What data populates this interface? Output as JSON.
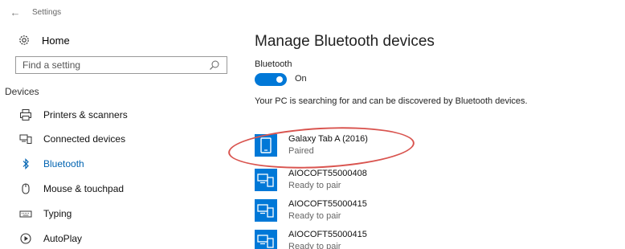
{
  "window": {
    "title": "Settings"
  },
  "sidebar": {
    "home_label": "Home",
    "search_placeholder": "Find a setting",
    "section_heading": "Devices",
    "items": [
      {
        "label": "Printers & scanners",
        "icon": "printer-icon",
        "active": false
      },
      {
        "label": "Connected devices",
        "icon": "connected-devices-icon",
        "active": false
      },
      {
        "label": "Bluetooth",
        "icon": "bluetooth-icon",
        "active": true
      },
      {
        "label": "Mouse & touchpad",
        "icon": "mouse-icon",
        "active": false
      },
      {
        "label": "Typing",
        "icon": "keyboard-icon",
        "active": false
      },
      {
        "label": "AutoPlay",
        "icon": "autoplay-icon",
        "active": false
      }
    ]
  },
  "main": {
    "title": "Manage Bluetooth devices",
    "bluetooth_label": "Bluetooth",
    "toggle_state": "On",
    "description": "Your PC is searching for and can be discovered by Bluetooth devices.",
    "devices": [
      {
        "name": "Galaxy Tab A (2016)",
        "status": "Paired",
        "icon": "tablet-icon"
      },
      {
        "name": "AIOCOFT55000408",
        "status": "Ready to pair",
        "icon": "computer-device-icon"
      },
      {
        "name": "AIOCOFT55000415",
        "status": "Ready to pair",
        "icon": "computer-device-icon"
      },
      {
        "name": "AIOCOFT55000415",
        "status": "Ready to pair",
        "icon": "computer-device-icon"
      }
    ]
  },
  "colors": {
    "accent": "#0078d7",
    "active_nav": "#0063b1",
    "highlight_annotation": "#d9544f"
  }
}
